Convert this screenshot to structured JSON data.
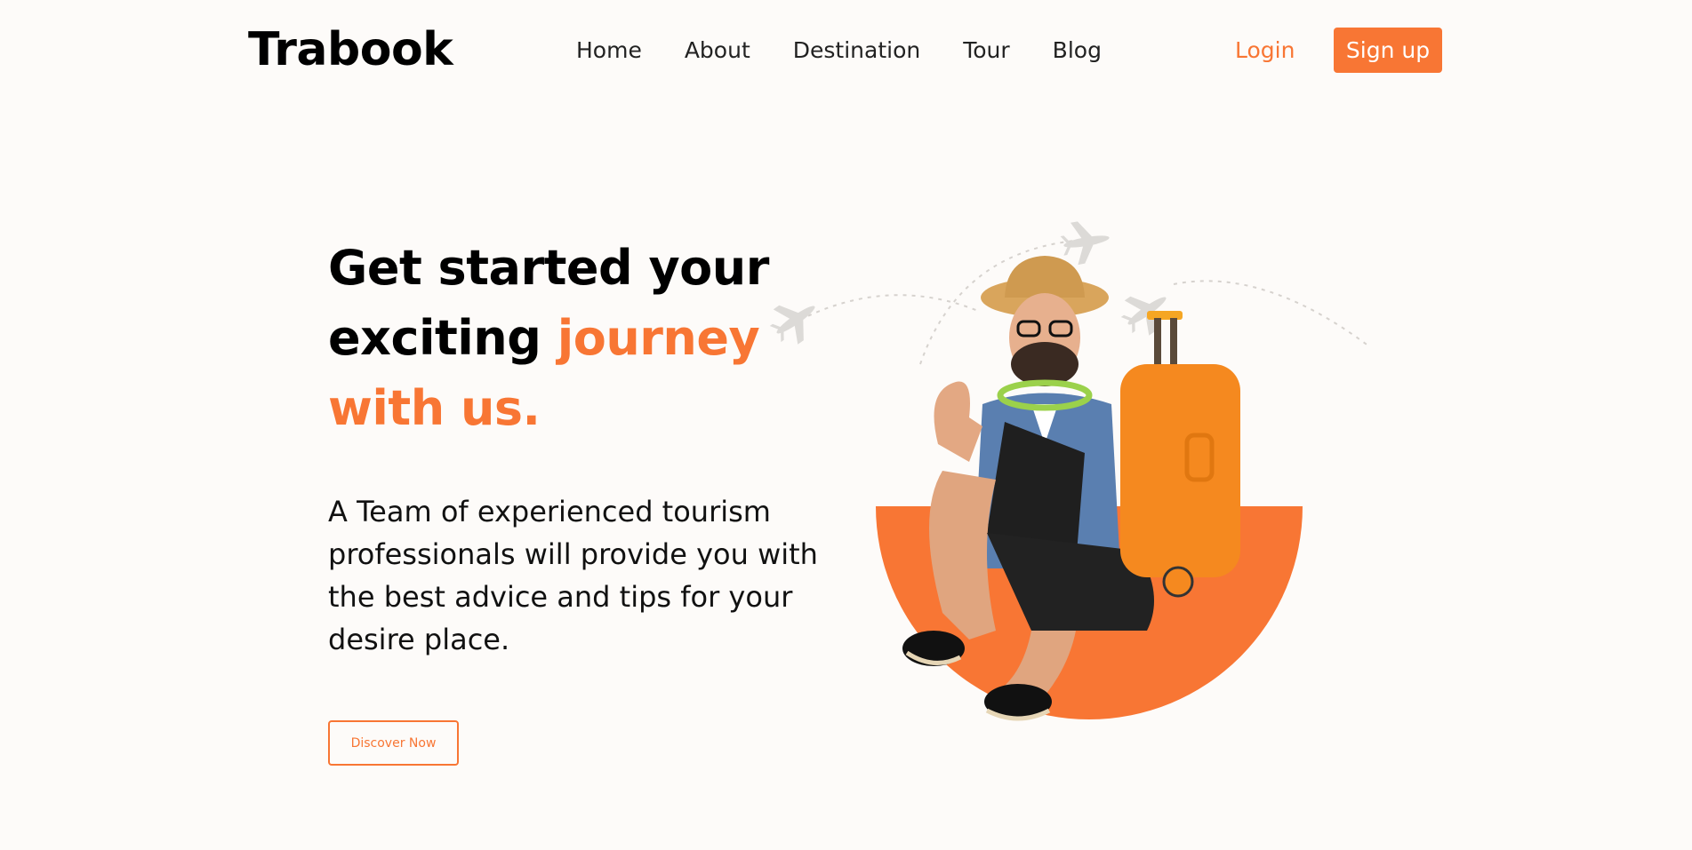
{
  "header": {
    "logo": "Trabook",
    "nav": [
      {
        "label": "Home"
      },
      {
        "label": "About"
      },
      {
        "label": "Destination"
      },
      {
        "label": "Tour"
      },
      {
        "label": "Blog"
      }
    ],
    "login_label": "Login",
    "signup_label": "Sign up"
  },
  "hero": {
    "headline_part1": "Get started your exciting",
    "headline_accent": "journey with us.",
    "description": "A Team of experienced tourism professionals will provide you with the best advice and tips for your desire place.",
    "cta_label": "Discover Now"
  },
  "colors": {
    "accent": "#f87634",
    "background": "#fdfbf9",
    "text": "#111111"
  },
  "icons": [
    "airplane-icon",
    "airplane-icon",
    "airplane-icon"
  ]
}
